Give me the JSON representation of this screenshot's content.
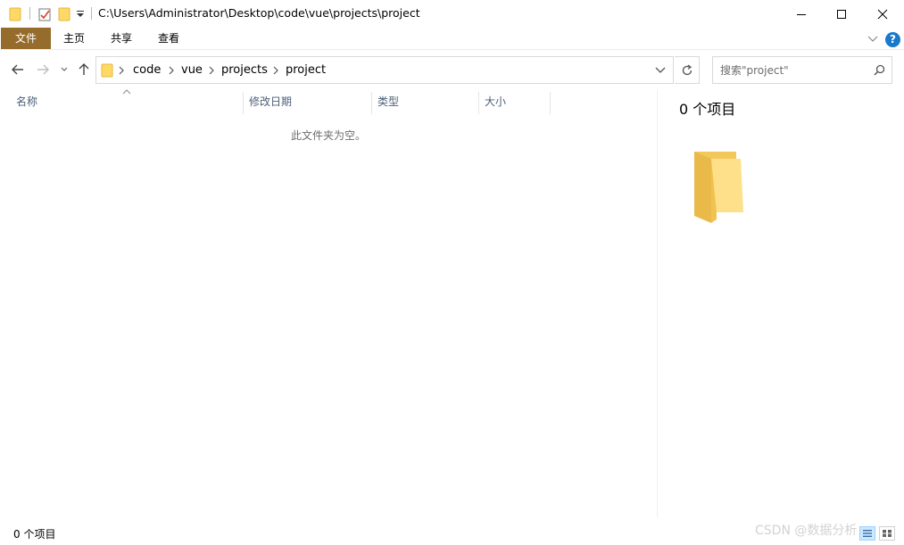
{
  "titlebar": {
    "path": "C:\\Users\\Administrator\\Desktop\\code\\vue\\projects\\project",
    "icons": [
      "folder-icon",
      "properties-icon",
      "new-folder-icon",
      "customize-quick-access-icon"
    ]
  },
  "window_buttons": {
    "minimize": "—",
    "maximize": "☐",
    "close": "✕"
  },
  "ribbon": {
    "tabs": [
      {
        "label": "文件"
      },
      {
        "label": "主页"
      },
      {
        "label": "共享"
      },
      {
        "label": "查看"
      }
    ]
  },
  "help": {
    "label": "?"
  },
  "address": {
    "crumbs": [
      {
        "label": "code"
      },
      {
        "label": "vue"
      },
      {
        "label": "projects"
      },
      {
        "label": "project"
      }
    ]
  },
  "search": {
    "placeholder": "搜索\"project\""
  },
  "columns": [
    {
      "label": "名称"
    },
    {
      "label": "修改日期"
    },
    {
      "label": "类型"
    },
    {
      "label": "大小"
    }
  ],
  "empty_message": "此文件夹为空。",
  "details": {
    "title": "0 个项目"
  },
  "status": {
    "text": "0 个项目"
  },
  "watermark": "CSDN @数据分析",
  "colors": {
    "file_tab": "#966c2c",
    "help": "#1979ca",
    "folder": "#ffd966",
    "header_text": "#4c607a"
  }
}
